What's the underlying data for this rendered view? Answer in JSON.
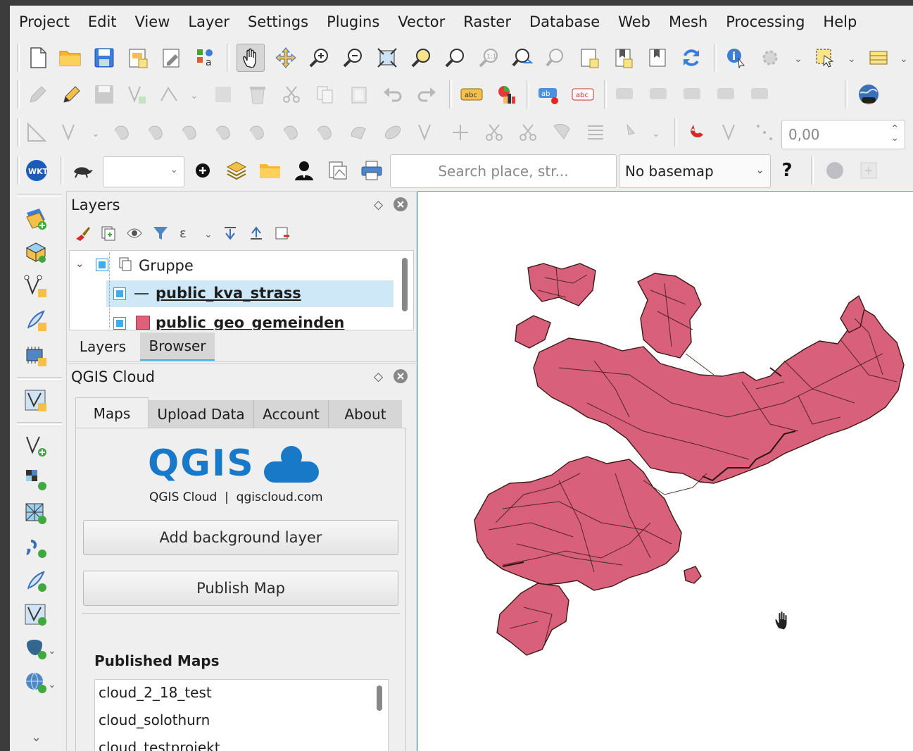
{
  "menu": [
    "Project",
    "Edit",
    "View",
    "Layer",
    "Settings",
    "Plugins",
    "Vector",
    "Raster",
    "Database",
    "Web",
    "Mesh",
    "Processing",
    "Help"
  ],
  "toolbar": {
    "search_placeholder": "Search place, str...",
    "basemap_select": "No basemap",
    "help_label": "?",
    "snapping_value": "0,00",
    "wkt_label": "WKT",
    "label_tool_text": "abc"
  },
  "layers_panel": {
    "title": "Layers",
    "tree": [
      {
        "label": "Gruppe",
        "type": "group",
        "checked": true
      },
      {
        "label": "public_kva_strass",
        "type": "line",
        "checked": true,
        "selected": true
      },
      {
        "label": "public_geo_gemeinden",
        "type": "polygon",
        "checked": true,
        "color": "#e0607a"
      }
    ],
    "tabs": [
      "Layers",
      "Browser"
    ]
  },
  "cloud_panel": {
    "title": "QGIS Cloud",
    "tabs": [
      "Maps",
      "Upload Data",
      "Account",
      "About"
    ],
    "logo_text": "QGIS",
    "logo_caption": "QGIS Cloud  |  qgiscloud.com",
    "add_background_label": "Add background layer",
    "publish_label": "Publish Map",
    "published_title": "Published Maps",
    "published_maps": [
      "cloud_2_18_test",
      "cloud_solothurn",
      "cloud_testprojekt"
    ]
  },
  "colors": {
    "polygon_fill": "#d9607a",
    "accent": "#3daee9",
    "logo_blue": "#1979c9"
  }
}
